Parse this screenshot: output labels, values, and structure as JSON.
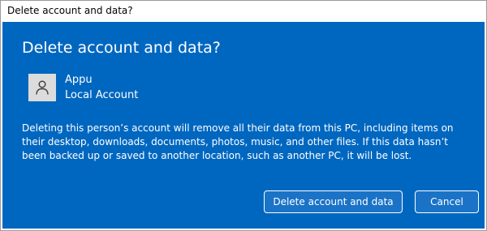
{
  "window": {
    "title": "Delete account and data?"
  },
  "dialog": {
    "heading": "Delete account and data?",
    "account": {
      "name": "Appu",
      "type": "Local Account",
      "avatar_icon": "person-icon"
    },
    "message": "Deleting this person’s account will remove all their data from this PC, including items on their desktop, downloads, documents, photos, music, and other files. If this data hasn’t been backed up or saved to another location, such as another PC, it will be lost.",
    "buttons": {
      "delete_label": "Delete account and data",
      "cancel_label": "Cancel"
    },
    "colors": {
      "background": "#0067c0",
      "text": "#ffffff",
      "avatar_background": "#dcdcdc"
    }
  }
}
